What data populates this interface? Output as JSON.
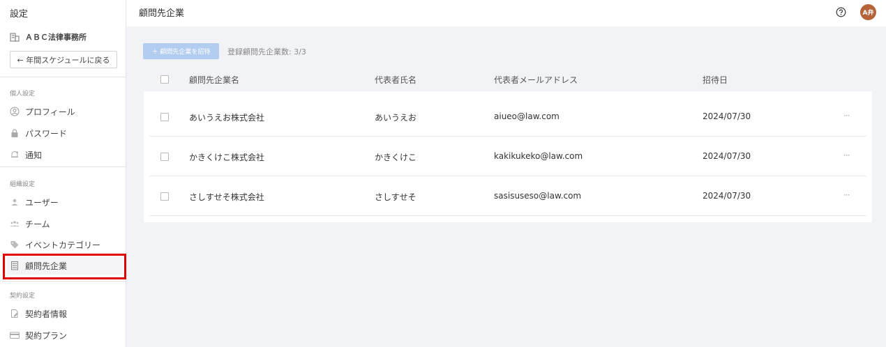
{
  "sidebar": {
    "title": "設定",
    "org_name": "ＡＢＣ法律事務所",
    "back_label": "← 年間スケジュールに戻る",
    "sections": [
      {
        "label": "個人設定",
        "items": [
          {
            "label": "プロフィール",
            "icon": "user-circle-icon"
          },
          {
            "label": "パスワード",
            "icon": "lock-icon"
          },
          {
            "label": "通知",
            "icon": "bell-icon"
          }
        ]
      },
      {
        "label": "組織設定",
        "items": [
          {
            "label": "ユーザー",
            "icon": "user-icon"
          },
          {
            "label": "チーム",
            "icon": "team-icon"
          },
          {
            "label": "イベントカテゴリー",
            "icon": "tag-icon"
          },
          {
            "label": "顧問先企業",
            "icon": "building-icon",
            "active": true
          }
        ]
      },
      {
        "label": "契約設定",
        "items": [
          {
            "label": "契約者情報",
            "icon": "document-edit-icon"
          },
          {
            "label": "契約プラン",
            "icon": "credit-card-icon"
          }
        ]
      }
    ]
  },
  "header": {
    "title": "顧問先企業",
    "avatar_text": "A弁"
  },
  "toolbar": {
    "invite_label": "＋ 顧問先企業を招待",
    "count_label": "登録顧問先企業数: 3/3"
  },
  "table": {
    "headers": [
      "顧問先企業名",
      "代表者氏名",
      "代表者メールアドレス",
      "招待日"
    ],
    "rows": [
      {
        "company": "あいうえお株式会社",
        "rep": "あいうえお",
        "email": "aiueo@law.com",
        "date": "2024/07/30",
        "more": "···"
      },
      {
        "company": "かきくけこ株式会社",
        "rep": "かきくけこ",
        "email": "kakikukeko@law.com",
        "date": "2024/07/30",
        "more": "···"
      },
      {
        "company": "さしすせそ株式会社",
        "rep": "さしすせそ",
        "email": "sasisuseso@law.com",
        "date": "2024/07/30",
        "more": "···"
      }
    ]
  }
}
